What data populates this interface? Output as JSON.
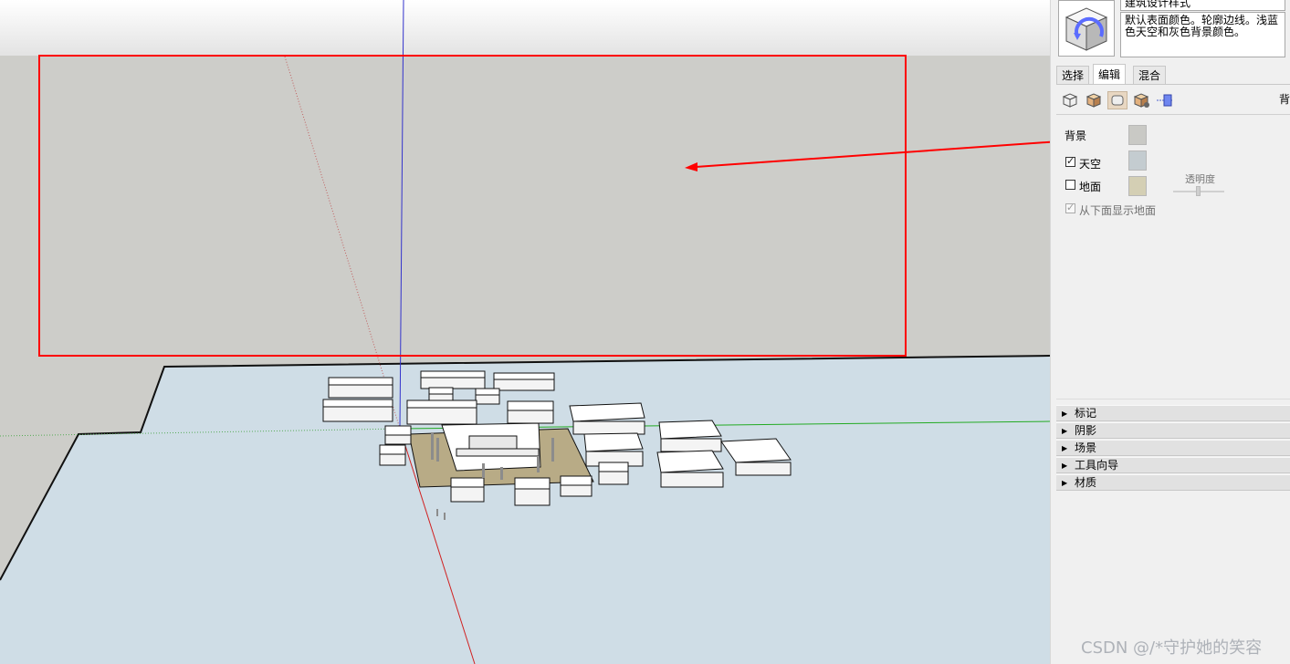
{
  "style_browser": {
    "style_name": "建筑设计样式",
    "description": "默认表面颜色。轮廓边线。浅蓝色天空和灰色背景颜色。"
  },
  "tabs": [
    {
      "label": "选择",
      "active": false
    },
    {
      "label": "编辑",
      "active": true
    },
    {
      "label": "混合",
      "active": false
    }
  ],
  "toolbar": {
    "icons": [
      "edge-settings-icon",
      "face-settings-icon",
      "background-settings-icon",
      "watermark-settings-icon",
      "modeling-settings-icon"
    ],
    "truncated_text": "背"
  },
  "background_settings": {
    "background_label": "背景",
    "background_color": "#c9c9c5",
    "sky_label": "天空",
    "sky_checked": true,
    "sky_color": "#c4ccd0",
    "ground_label": "地面",
    "ground_checked": false,
    "ground_color": "#d4cfb4",
    "opacity_label": "透明度",
    "show_ground_from_below_label": "从下面显示地面",
    "show_ground_from_below_checked": true
  },
  "panels": [
    {
      "label": "标记"
    },
    {
      "label": "阴影"
    },
    {
      "label": "场景"
    },
    {
      "label": "工具向导"
    },
    {
      "label": "材质"
    }
  ],
  "viewport": {
    "background_color": "#cdcdc9",
    "sky_color": "#f0f0f0",
    "ground_color": "#cfdde6"
  },
  "watermark": "CSDN @/*守护她的笑容"
}
